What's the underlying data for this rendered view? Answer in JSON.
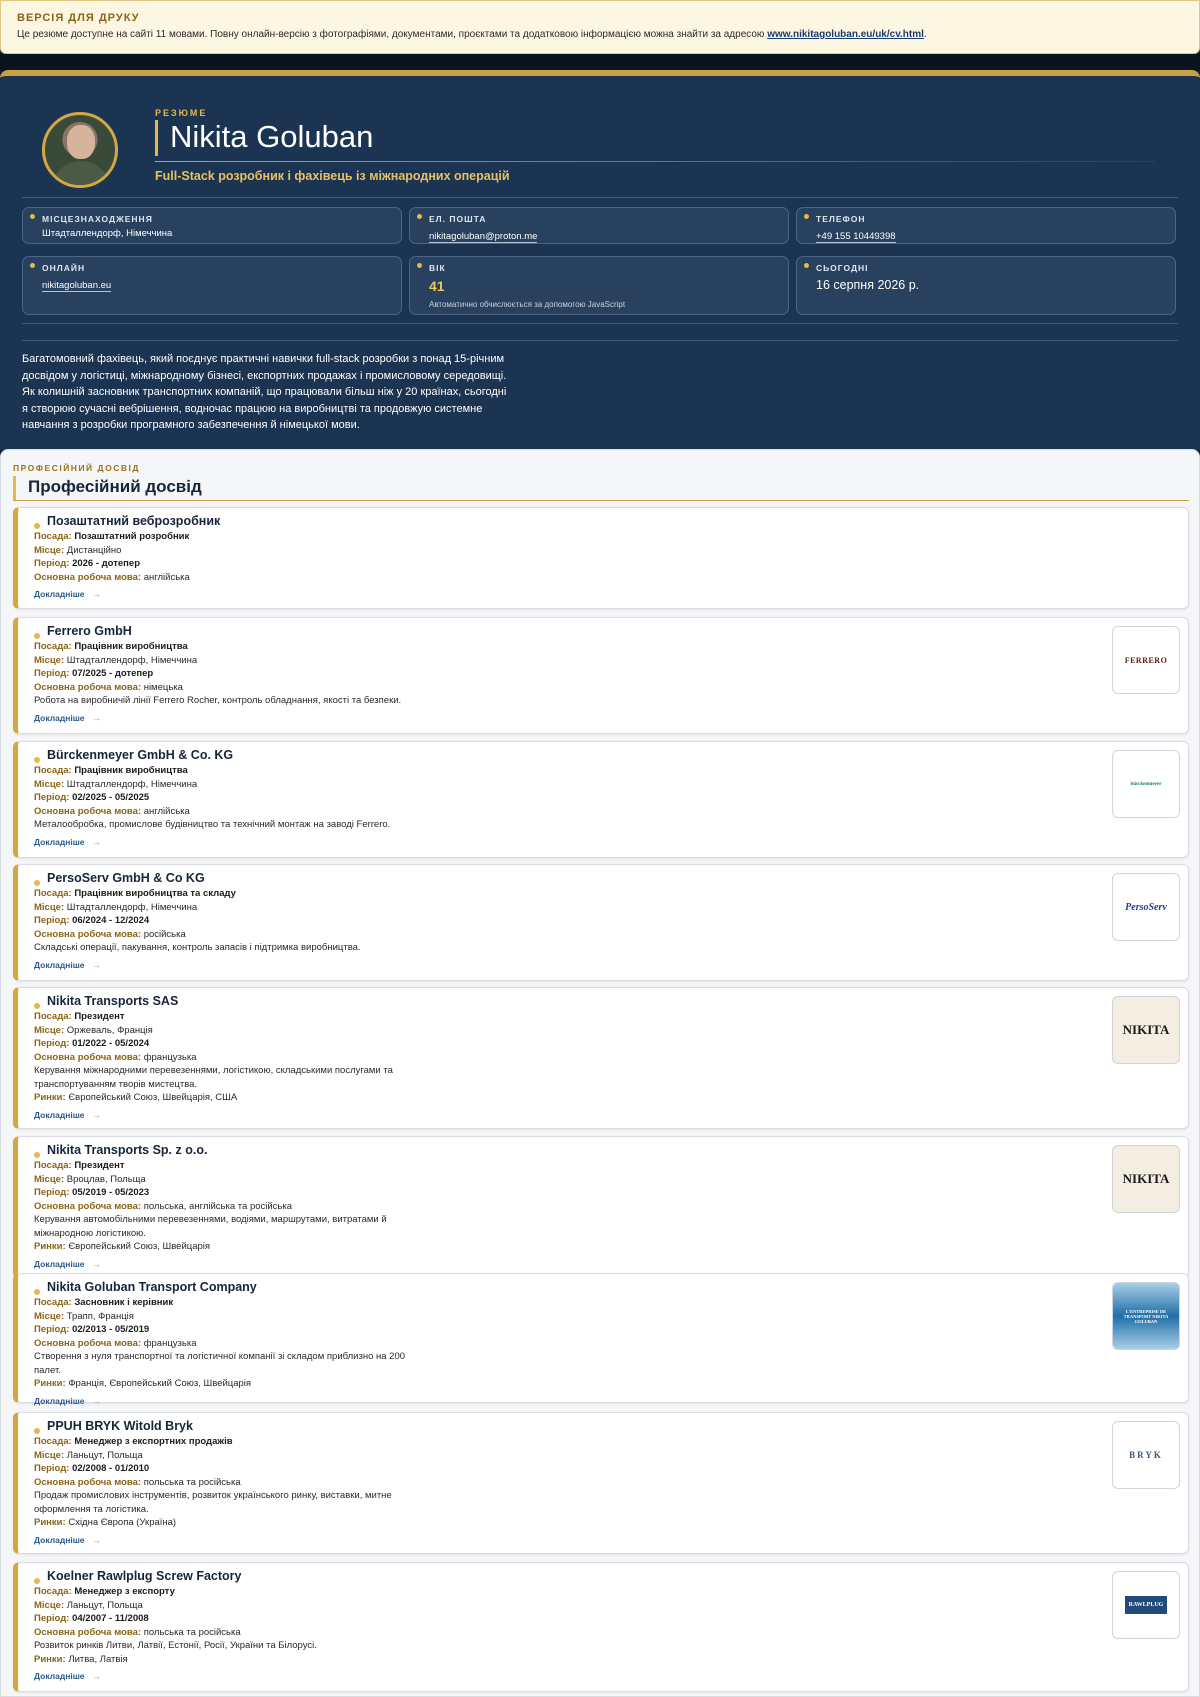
{
  "banner": {
    "title": "ВЕРСІЯ ДЛЯ ДРУКУ",
    "text": "Це резюме доступне на сайті 11 мовами. Повну онлайн-версію з фотографіями, документами, проєктами та додатковою інформацією можна знайти за адресою ",
    "link": "www.nikitagoluban.eu/uk/cv.html",
    "end": "."
  },
  "header": {
    "kicker": "РЕЗЮМЕ",
    "name": "Nikita Goluban",
    "subtitle": "Full-Stack розробник і фахівець із міжнародних операцій"
  },
  "cards": {
    "location": {
      "label": "МІСЦЕЗНАХОДЖЕННЯ",
      "value": "Штадталлендорф, Німеччина"
    },
    "email": {
      "label": "ЕЛ. ПОШТА",
      "value": "nikitagoluban@proton.me"
    },
    "phone": {
      "label": "ТЕЛЕФОН",
      "value": "+49 155 10449398"
    },
    "online": {
      "label": "ОНЛАЙН",
      "value": "nikitagoluban.eu"
    },
    "age": {
      "label": "ВІК",
      "value": "41",
      "note": "Автоматично обчислюється за допомогою JavaScript"
    },
    "today": {
      "label": "СЬОГОДНІ",
      "value": "16 серпня 2026 р."
    }
  },
  "summary": "Багатомовний фахівець, який поєднує практичні навички full-stack розробки з понад 15-річним досвідом у логістиці, міжнародному бізнесі, експортних продажах і промисловому середовищі. Як колишній засновник транспортних компаній, що працювали більш ніж у 20 країнах, сьогодні я створюю сучасні вебрішення, водночас працюю на виробництві та продовжую системне навчання з розробки програмного забезпечення й німецької мови.",
  "experience": {
    "kicker": "ПРОФЕСІЙНИЙ ДОСВІД",
    "title": "Професійний досвід",
    "labels": {
      "position": "Посада:",
      "place": "Місце:",
      "period": "Період:",
      "language": "Основна робоча мова:",
      "markets": "Ринки:",
      "more": "Докладніше",
      "arrow": "→"
    },
    "jobs": [
      {
        "company": "Позаштатний веброзробник",
        "position": "Позаштатний розробник",
        "place": "Дистанційно",
        "period": "2026 - дотепер",
        "language": "англійська",
        "desc": "",
        "markets": "",
        "logo": ""
      },
      {
        "company": "Ferrero GmbH",
        "position": "Працівник виробництва",
        "place": "Штадталлендорф, Німеччина",
        "period": "07/2025 - дотепер",
        "language": "німецька",
        "desc": "Робота на виробничій лінії Ferrero Rocher, контроль обладнання, якості та безпеки.",
        "markets": "",
        "logo": "FERRERO"
      },
      {
        "company": "Bürckenmeyer GmbH & Co. KG",
        "position": "Працівник виробництва",
        "place": "Штадталлендорф, Німеччина",
        "period": "02/2025 - 05/2025",
        "language": "англійська",
        "desc": "Металообробка, промислове будівництво та технічний монтаж на заводі Ferrero.",
        "markets": "",
        "logo": "bürckenmeyer"
      },
      {
        "company": "PersoServ GmbH & Co KG",
        "position": "Працівник виробництва та складу",
        "place": "Штадталлендорф, Німеччина",
        "period": "06/2024 - 12/2024",
        "language": "російська",
        "desc": "Складські операції, пакування, контроль запасів і підтримка виробництва.",
        "markets": "",
        "logo": "PersoServ"
      },
      {
        "company": "Nikita Transports SAS",
        "position": "Президент",
        "place": "Оржеваль, Франція",
        "period": "01/2022 - 05/2024",
        "language": "французька",
        "desc": "Керування міжнародними перевезеннями, логістикою, складськими послугами та транспортуванням творів мистецтва.",
        "markets": "Європейський Союз, Швейцарія, США",
        "logo": "NIKITA"
      },
      {
        "company": "Nikita Transports Sp. z o.o.",
        "position": "Президент",
        "place": "Вроцлав, Польща",
        "period": "05/2019 - 05/2023",
        "language": "польська, англійська та російська",
        "desc": "Керування автомобільними перевезеннями, водіями, маршрутами, витратами й міжнародною логістикою.",
        "markets": "Європейський Союз, Швейцарія",
        "logo": "NIKITA"
      },
      {
        "company": "Nikita Goluban Transport Company",
        "position": "Засновник і керівник",
        "place": "Трапп, Франція",
        "period": "02/2013 - 05/2019",
        "language": "французька",
        "desc": "Створення з нуля транспортної та логістичної компанії зі складом приблизно на 200 палет.",
        "markets": "Франція, Європейський Союз, Швейцарія",
        "logo": "L'ENTREPRISE DE TRANSPORT NIKITA GOLUBAN"
      },
      {
        "company": "PPUH BRYK Witold Bryk",
        "position": "Менеджер з експортних продажів",
        "place": "Ланьцут, Польща",
        "period": "02/2008 - 01/2010",
        "language": "польська та російська",
        "desc": "Продаж промислових інструментів, розвиток українського ринку, виставки, митне оформлення та логістика.",
        "markets": "Східна Європа (Україна)",
        "logo": "BRYK"
      },
      {
        "company": "Koelner Rawlplug Screw Factory",
        "position": "Менеджер з експорту",
        "place": "Ланьцут, Польща",
        "period": "04/2007 - 11/2008",
        "language": "польська та російська",
        "desc": "Розвиток ринків Литви, Латвії, Естонії, Росії, України та Білорусі.",
        "markets": "Литва, Латвія",
        "logo": "RAWLPLUG"
      }
    ]
  }
}
